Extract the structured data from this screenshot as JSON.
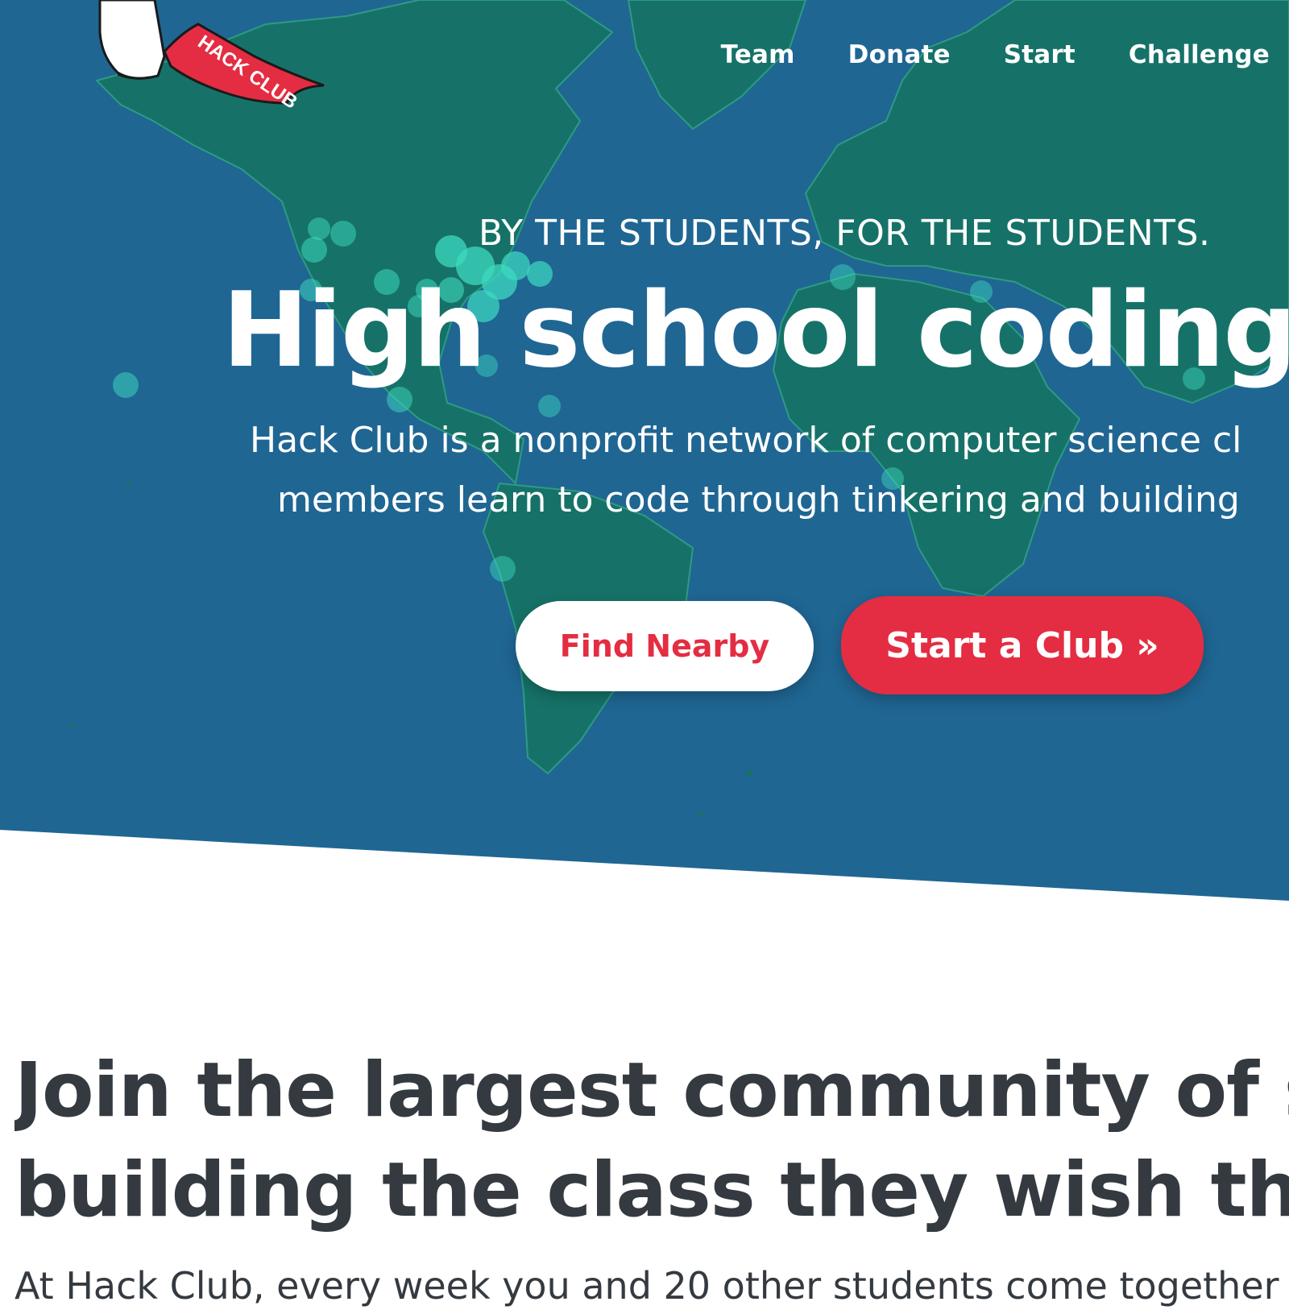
{
  "logo": {
    "text": "HACK CLUB"
  },
  "nav": {
    "items": [
      {
        "label": "Team"
      },
      {
        "label": "Donate"
      },
      {
        "label": "Start"
      },
      {
        "label": "Challenge"
      }
    ]
  },
  "hero": {
    "eyebrow": "BY THE STUDENTS, FOR THE STUDENTS.",
    "headline": "High school coding cl",
    "lede_line_1": "Hack Club is a nonprofit network of computer science cl",
    "lede_line_2": "members learn to code through tinkering and building",
    "find_button": "Find Nearby",
    "start_button": "Start a Club »"
  },
  "section": {
    "title_line_1": "Join the largest community of stud",
    "title_line_2": "building the class they wish they h",
    "body_line_1": "At Hack Club, every week you and 20 other students come together"
  },
  "colors": {
    "ocean": "#1f6693",
    "land": "#167268",
    "land_border": "#2d9b83",
    "club_dot": "#3ddbc0",
    "brand_red": "#e42d42",
    "text_dark": "#343a40"
  }
}
